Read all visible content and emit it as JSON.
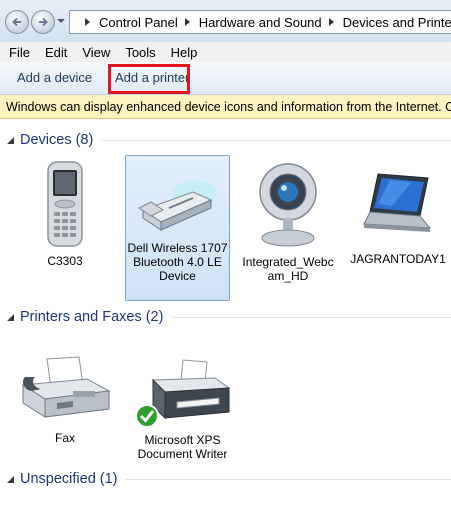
{
  "address_bar": {
    "breadcrumbs": [
      "Control Panel",
      "Hardware and Sound",
      "Devices and Printers"
    ]
  },
  "menu": [
    "File",
    "Edit",
    "View",
    "Tools",
    "Help"
  ],
  "command_bar": {
    "add_device": "Add a device",
    "add_printer": "Add a printer"
  },
  "infobar": {
    "text": "Windows can display enhanced device icons and information from the Internet. Click"
  },
  "groups": {
    "devices": {
      "title": "Devices (8)",
      "items": [
        {
          "label": "C3303",
          "icon": "mobile-phone-icon"
        },
        {
          "label": "Dell Wireless 1707 Bluetooth 4.0 LE Device",
          "line1": "Dell Wireless 1707",
          "line2": "Bluetooth 4.0 LE",
          "line3": "Device",
          "icon": "usb-adapter-icon",
          "selected": true
        },
        {
          "label": "Integrated_Webcam_HD",
          "line1": "Integrated_Webc",
          "line2": "am_HD",
          "icon": "webcam-icon"
        },
        {
          "label": "JAGRANTODAY1",
          "icon": "laptop-icon"
        }
      ]
    },
    "printers": {
      "title": "Printers and Faxes (2)",
      "items": [
        {
          "label": "Fax",
          "icon": "fax-icon"
        },
        {
          "label": "Microsoft XPS Document Writer",
          "line1": "Microsoft XPS",
          "line2": "Document Writer",
          "icon": "printer-icon",
          "default": true
        }
      ]
    },
    "unspecified": {
      "title": "Unspecified (1)"
    }
  },
  "colors": {
    "group_title": "#1e3287",
    "highlight_border": "#e0161e",
    "infobar_bg": "#fcf3c0"
  }
}
